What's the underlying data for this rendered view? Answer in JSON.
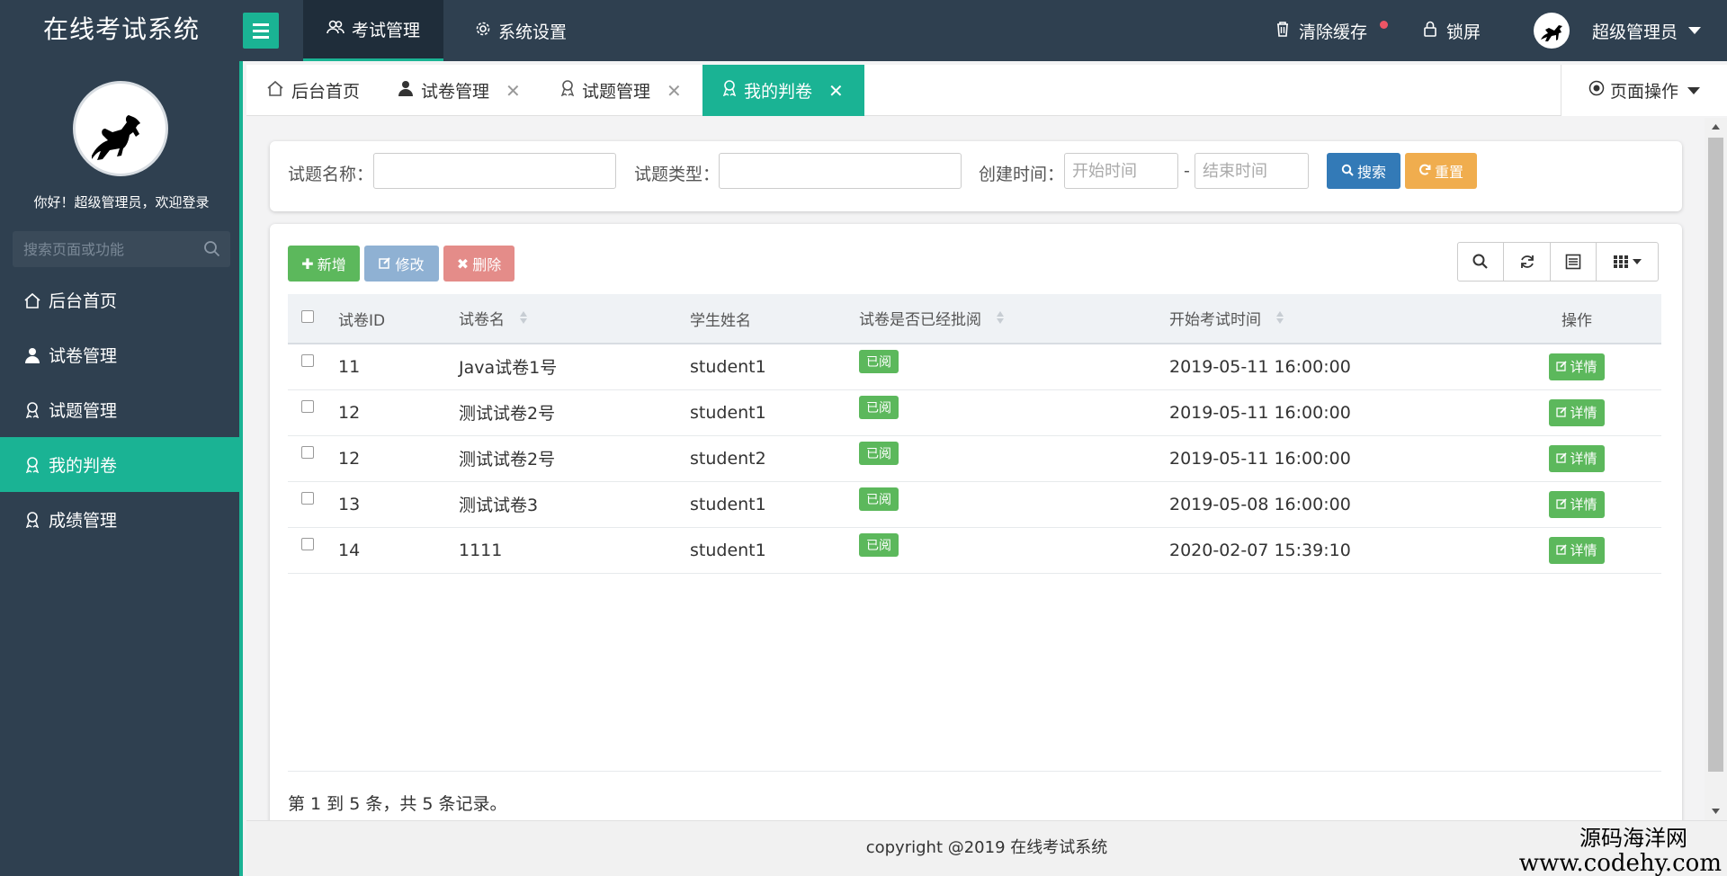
{
  "app": {
    "title": "在线考试系统"
  },
  "header": {
    "nav": [
      {
        "label": "考试管理",
        "icon": "users-icon",
        "active": true
      },
      {
        "label": "系统设置",
        "icon": "gear-icon",
        "active": false
      }
    ],
    "clear_cache": "清除缓存",
    "lock": "锁屏",
    "user": "超级管理员"
  },
  "sidebar": {
    "welcome": "你好！超级管理员，欢迎登录",
    "search_placeholder": "搜索页面或功能",
    "items": [
      {
        "label": "后台首页",
        "icon": "home-icon"
      },
      {
        "label": "试卷管理",
        "icon": "user-icon"
      },
      {
        "label": "试题管理",
        "icon": "award-icon"
      },
      {
        "label": "我的判卷",
        "icon": "award-icon",
        "active": true
      },
      {
        "label": "成绩管理",
        "icon": "award-icon"
      }
    ]
  },
  "tabs": [
    {
      "label": "后台首页",
      "icon": "home-icon",
      "closable": false
    },
    {
      "label": "试卷管理",
      "icon": "user-icon",
      "closable": true
    },
    {
      "label": "试题管理",
      "icon": "award-icon",
      "closable": true
    },
    {
      "label": "我的判卷",
      "icon": "award-icon",
      "closable": true,
      "active": true
    }
  ],
  "page_ops": "页面操作",
  "search": {
    "name_label": "试题名称：",
    "type_label": "试题类型：",
    "time_label": "创建时间：",
    "start_placeholder": "开始时间",
    "end_placeholder": "结束时间",
    "sep": "-",
    "search_btn": "搜索",
    "reset_btn": "重置"
  },
  "toolbar": {
    "add": "新增",
    "edit": "修改",
    "delete": "删除"
  },
  "table": {
    "columns": [
      "试卷ID",
      "试卷名",
      "学生姓名",
      "试卷是否已经批阅",
      "开始考试时间",
      "操作"
    ],
    "rows": [
      {
        "id": "11",
        "name": "Java试卷1号",
        "student": "student1",
        "status": "已阅",
        "time": "2019-05-11 16:00:00",
        "action": "详情"
      },
      {
        "id": "12",
        "name": "测试试卷2号",
        "student": "student1",
        "status": "已阅",
        "time": "2019-05-11 16:00:00",
        "action": "详情"
      },
      {
        "id": "12",
        "name": "测试试卷2号",
        "student": "student2",
        "status": "已阅",
        "time": "2019-05-11 16:00:00",
        "action": "详情"
      },
      {
        "id": "13",
        "name": "测试试卷3",
        "student": "student1",
        "status": "已阅",
        "time": "2019-05-08 16:00:00",
        "action": "详情"
      },
      {
        "id": "14",
        "name": "1111",
        "student": "student1",
        "status": "已阅",
        "time": "2020-02-07 15:39:10",
        "action": "详情"
      }
    ],
    "pager": "第 1 到 5 条，共 5 条记录。"
  },
  "footer": "copyright @2019 在线考试系统",
  "watermark": {
    "line1": "源码海洋网",
    "line2": "www.codehy.com"
  },
  "colors": {
    "accent": "#1ab394",
    "sidebar": "#2f4050",
    "primary": "#337ab7",
    "warning": "#f0ad4e",
    "danger": "#d9534f",
    "success": "#5cb85c"
  }
}
